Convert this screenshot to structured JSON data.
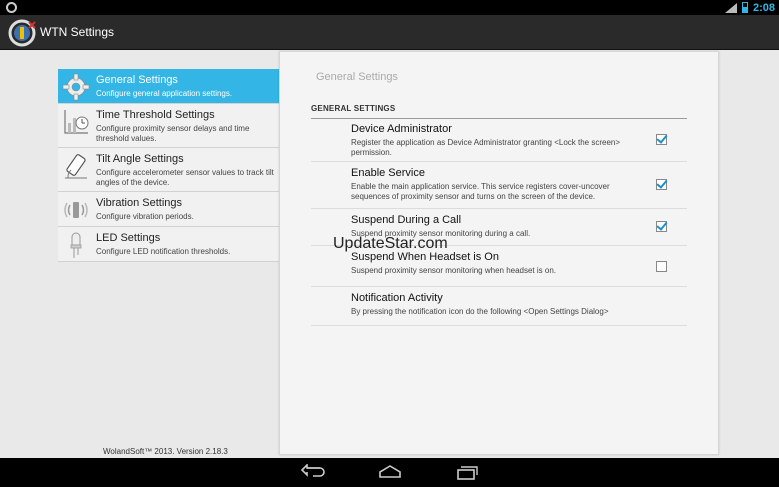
{
  "status_bar": {
    "time": "2:08"
  },
  "action_bar": {
    "title": "WTN Settings",
    "icon": "wtn-app-icon"
  },
  "sidebar": {
    "items": [
      {
        "title": "General Settings",
        "summary": "Configure general application settings.",
        "icon": "gear-icon",
        "selected": true
      },
      {
        "title": "Time Threshold Settings",
        "summary": "Configure proximity sensor delays and time threshold values.",
        "icon": "chart-clock-icon"
      },
      {
        "title": "Tilt Angle Settings",
        "summary": "Configure accelerometer sensor values to track tilt angles of the device.",
        "icon": "tilt-phone-icon"
      },
      {
        "title": "Vibration Settings",
        "summary": "Configure vibration periods.",
        "icon": "vibration-icon"
      },
      {
        "title": "LED Settings",
        "summary": "Configure LED notification thresholds.",
        "icon": "led-bulb-icon"
      }
    ],
    "footer": "WolandSoft™ 2013. Version 2.18.3"
  },
  "panel": {
    "title": "General Settings",
    "category": "GENERAL SETTINGS",
    "prefs": [
      {
        "title": "Device Administrator",
        "summary": "Register the application as Device Administrator granting <Lock the screen> permission.",
        "checked": true
      },
      {
        "title": "Enable Service",
        "summary": "Enable the main application service. This service registers cover-uncover sequences of proximity sensor and turns on the screen of the device.",
        "checked": true
      },
      {
        "title": "Suspend During a Call",
        "summary": "Suspend proximity sensor monitoring during a call.",
        "checked": true
      },
      {
        "title": "Suspend When Headset is On",
        "summary": "Suspend proximity sensor monitoring when headset is on.",
        "checked": false
      },
      {
        "title": "Notification Activity",
        "summary": "By pressing the notification icon do the following <Open Settings Dialog>"
      }
    ]
  },
  "watermark": "UpdateStar.com",
  "nav_bar": {
    "buttons": [
      "back-icon",
      "home-icon",
      "recents-icon"
    ]
  },
  "colors": {
    "accent": "#33b5e5",
    "actionbar": "#2a2a2a",
    "background": "#e9e9e9"
  }
}
